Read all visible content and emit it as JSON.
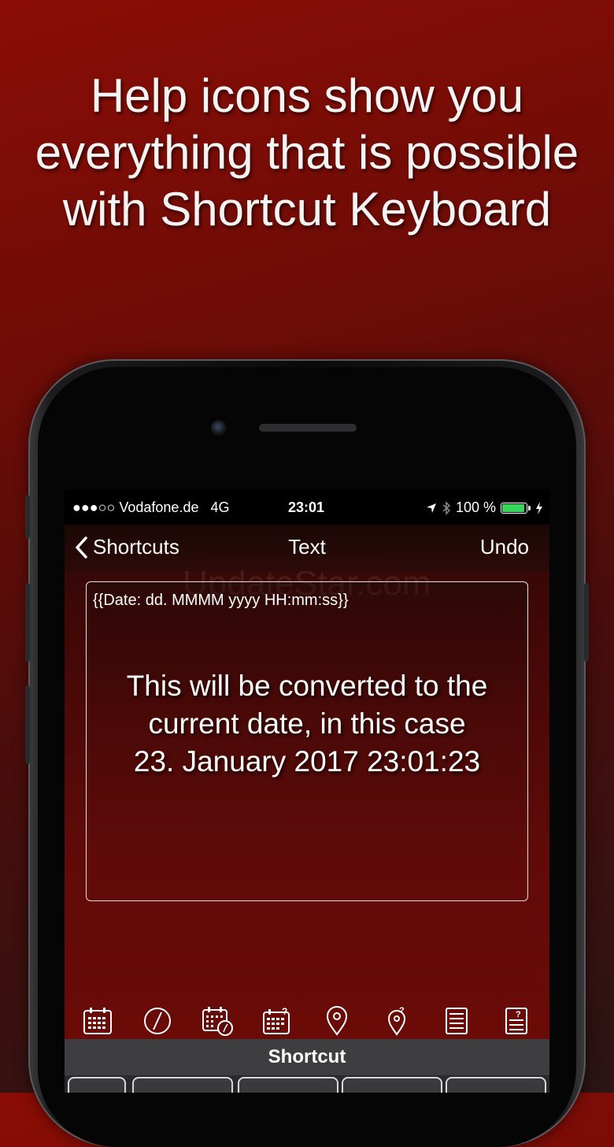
{
  "headline": "Help icons show you everything that is possible with Shortcut Keyboard",
  "status_bar": {
    "carrier": "●●●○○ Vodafone.de",
    "network": "4G",
    "time": "23:01",
    "battery": "100 %"
  },
  "nav": {
    "back_label": "Shortcuts",
    "title": "Text",
    "undo_label": "Undo",
    "watermark": "UpdateStar.com"
  },
  "editor": {
    "content": "{{Date: dd. MMMM yyyy HH:mm:ss}}"
  },
  "callout": {
    "line1": "This will be converted to the",
    "line2": "current date, in this case",
    "line3": "23. January 2017 23:01:23"
  },
  "toolbar": {
    "icons": [
      "calendar-icon",
      "clock-icon",
      "calendar-time-icon",
      "calendar-help-icon",
      "location-pin-icon",
      "location-help-icon",
      "list-icon",
      "list-help-icon"
    ]
  },
  "keyboard": {
    "bar_label": "Shortcut"
  },
  "colors": {
    "background": "#7a0c06",
    "battery": "#37d65a",
    "keyboard_bar": "#3e3e40"
  }
}
